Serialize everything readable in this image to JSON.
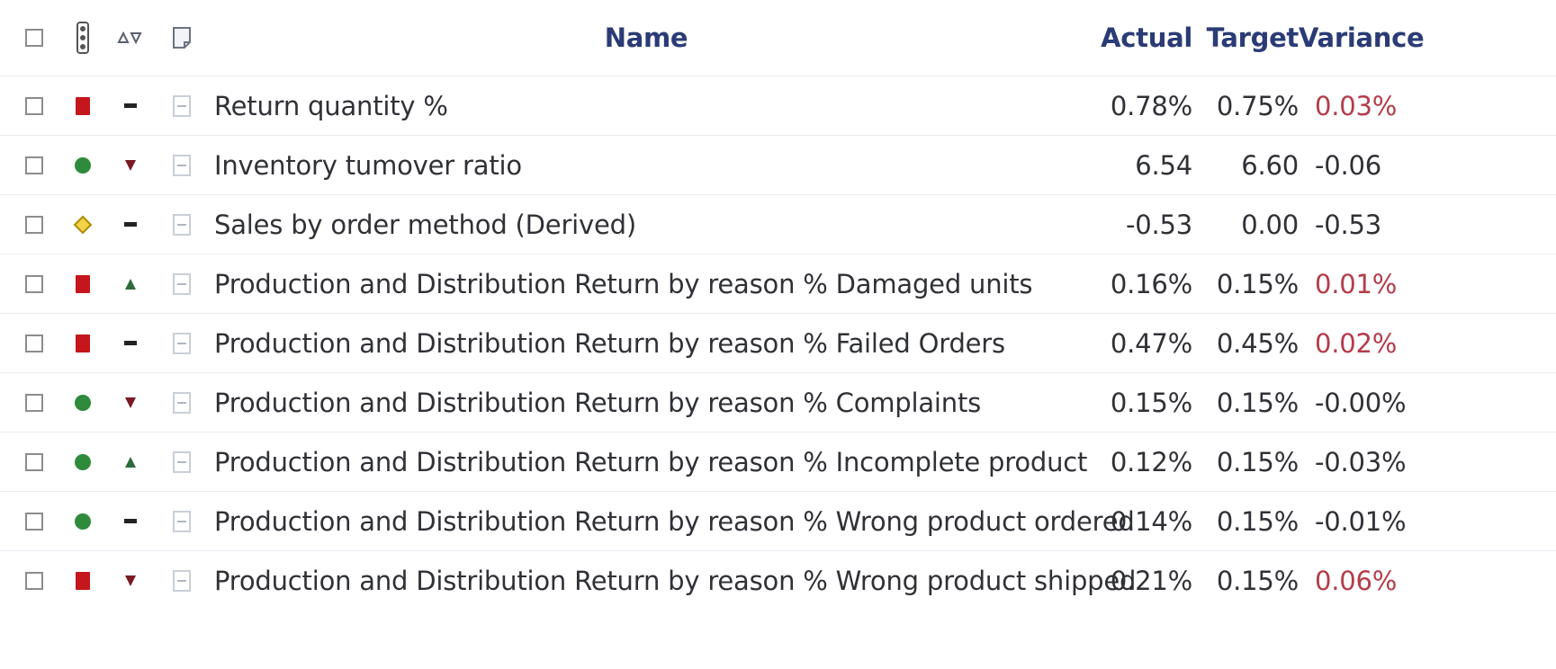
{
  "header": {
    "name_label": "Name",
    "actual_label": "Actual",
    "target_label": "Target",
    "variance_label": "Variance",
    "icons": [
      "select-all-checkbox",
      "status-column-icon",
      "trend-column-icon",
      "notes-column-icon"
    ]
  },
  "rows": [
    {
      "status": "red-square",
      "trend": "dash",
      "name": "Return quantity %",
      "actual": "0.78%",
      "target": "0.75%",
      "variance": "0.03%",
      "variance_color": "#b43c4a"
    },
    {
      "status": "green-circle",
      "trend": "down",
      "name": "Inventory tumover ratio",
      "actual": "6.54",
      "target": "6.60",
      "variance": "-0.06",
      "variance_color": "#2f3136"
    },
    {
      "status": "yellow-diamond",
      "trend": "dash",
      "name": "Sales by order method (Derived)",
      "actual": "-0.53",
      "target": "0.00",
      "variance": "-0.53",
      "variance_color": "#2f3136"
    },
    {
      "status": "red-square",
      "trend": "up",
      "name": "Production and Distribution Return by reason % Damaged units",
      "actual": "0.16%",
      "target": "0.15%",
      "variance": "0.01%",
      "variance_color": "#b43c4a"
    },
    {
      "status": "red-square",
      "trend": "dash",
      "name": "Production and Distribution Return by reason % Failed Orders",
      "actual": "0.47%",
      "target": "0.45%",
      "variance": "0.02%",
      "variance_color": "#b43c4a"
    },
    {
      "status": "green-circle",
      "trend": "down",
      "name": "Production and Distribution Return by reason % Complaints",
      "actual": "0.15%",
      "target": "0.15%",
      "variance": "-0.00%",
      "variance_color": "#2f3136"
    },
    {
      "status": "green-circle",
      "trend": "up",
      "name": "Production and Distribution Return by reason % Incomplete product",
      "actual": "0.12%",
      "target": "0.15%",
      "variance": "-0.03%",
      "variance_color": "#2f3136"
    },
    {
      "status": "green-circle",
      "trend": "dash",
      "name": "Production and Distribution Return by reason % Wrong product ordered",
      "actual": "0.14%",
      "target": "0.15%",
      "variance": "-0.01%",
      "variance_color": "#2f3136"
    },
    {
      "status": "red-square",
      "trend": "down",
      "name": "Production and Distribution Return by reason % Wrong product shipped",
      "actual": "0.21%",
      "target": "0.15%",
      "variance": "0.06%",
      "variance_color": "#b43c4a"
    }
  ],
  "colors": {
    "header_text": "#2a3b76",
    "status_red": "#c4161c",
    "status_green": "#2e8b3b",
    "status_yellow": "#d9b100",
    "trend_up": "#2f6b3a",
    "trend_down": "#7a1a24",
    "variance_positive": "#b43c4a"
  }
}
